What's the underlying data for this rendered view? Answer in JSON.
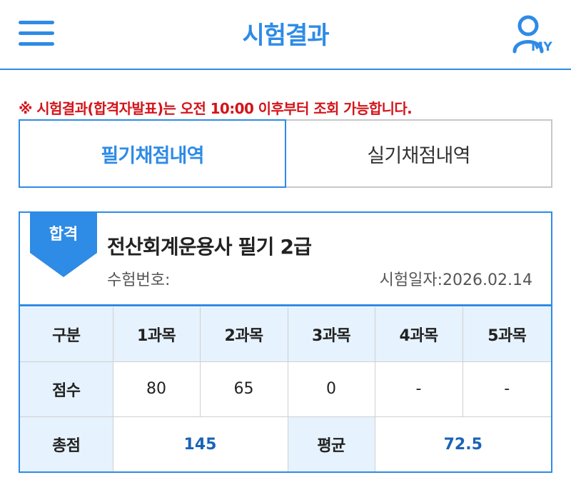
{
  "header": {
    "title": "시험결과",
    "my_label": "MY"
  },
  "notice": "※ 시험결과(합격자발표)는 오전 10:00 이후부터 조회 가능합니다.",
  "tabs": [
    {
      "label": "필기채점내역",
      "active": true
    },
    {
      "label": "실기채점내역",
      "active": false
    }
  ],
  "result": {
    "badge": "합격",
    "exam_name": "전산회계운용사 필기 2급",
    "exam_no_label": "수험번호:",
    "exam_no_value": "",
    "exam_date_label": "시험일자:",
    "exam_date_value": "2026.02.14",
    "table": {
      "headers": [
        "구분",
        "1과목",
        "2과목",
        "3과목",
        "4과목",
        "5과목"
      ],
      "score_label": "점수",
      "scores": [
        "80",
        "65",
        "0",
        "-",
        "-"
      ],
      "total_label": "총점",
      "total_value": "145",
      "average_label": "평균",
      "average_value": "72.5"
    }
  },
  "colors": {
    "primary": "#2e8be6",
    "notice_red": "#d4141a",
    "header_cell_bg": "#e6f2fd",
    "value_blue": "#1a63b8"
  },
  "icons": [
    "menu-icon",
    "user-icon"
  ]
}
